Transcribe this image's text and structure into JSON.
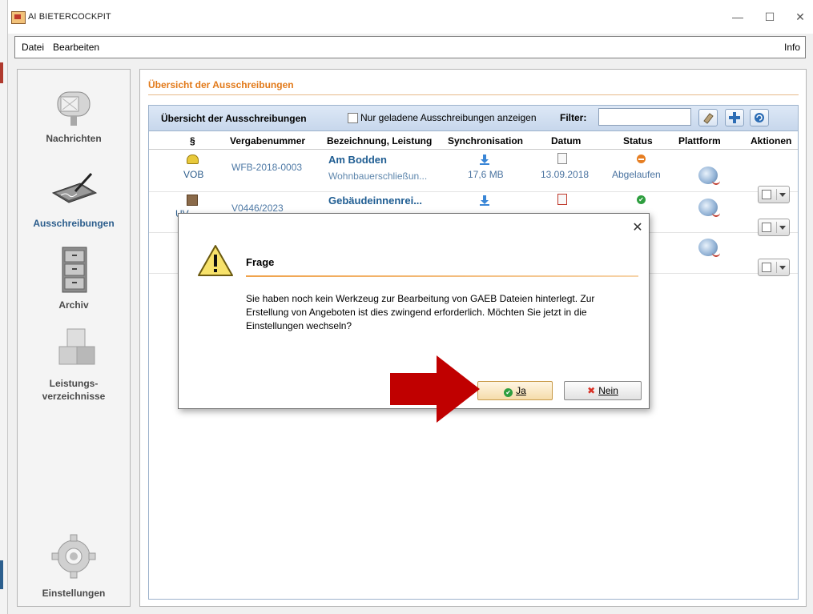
{
  "window": {
    "title": "AI BIETERCOCKPIT",
    "controls": {
      "minimize": "—",
      "maximize": "☐",
      "close": "✕"
    }
  },
  "menu": {
    "datei": "Datei",
    "bearbeiten": "Bearbeiten",
    "info": "Info"
  },
  "sidebar": {
    "items": [
      {
        "label": "Nachrichten",
        "icon": "mailbox-icon",
        "active": false
      },
      {
        "label": "Ausschreibungen",
        "icon": "signature-pad-icon",
        "active": true
      },
      {
        "label": "Archiv",
        "icon": "file-cabinet-icon",
        "active": false
      },
      {
        "label_line1": "Leistungs-",
        "label_line2": "verzeichnisse",
        "icon": "cubes-icon",
        "active": false
      },
      {
        "label": "Einstellungen",
        "icon": "gear-icon",
        "active": false
      }
    ]
  },
  "main": {
    "heading": "Übersicht der Ausschreibungen",
    "grid": {
      "title": "Übersicht der Ausschreibungen",
      "checkbox_label": "Nur geladene Ausschreibungen anzeigen",
      "filter_label": "Filter:",
      "filter_value": "",
      "columns": [
        "§",
        "Vergabenummer",
        "Bezeichnung, Leistung",
        "Synchronisation",
        "Datum",
        "Status",
        "Plattform",
        "Aktionen"
      ],
      "rows": [
        {
          "law": "VOB",
          "number": "WFB-2018-0003",
          "title": "Am Bodden",
          "subtitle": "Wohnbauerschließun...",
          "sync_size": "17,6 MB",
          "date": "13.09.2018",
          "status": "Abgelaufen"
        },
        {
          "law": "UV",
          "number": "V0446/2023",
          "title": "Gebäudeinnenrei...",
          "subtitle": "",
          "sync_size": "",
          "date": "",
          "status": ""
        },
        {
          "law": "",
          "number": "",
          "title": "",
          "subtitle": "",
          "sync_size": "",
          "date": "",
          "status": ""
        }
      ]
    }
  },
  "dialog": {
    "title": "Frage",
    "message": "Sie haben noch kein Werkzeug zur Bearbeitung von GAEB Dateien hinterlegt. Zur Erstellung von Angeboten ist dies zwingend erforderlich. Möchten Sie jetzt in die Einstellungen wechseln?",
    "yes_label": "Ja",
    "no_label": "Nein",
    "close": "✕"
  },
  "colors": {
    "accent_orange": "#e27a1a",
    "nav_active": "#2b5d8c",
    "arrow_red": "#c00000"
  }
}
